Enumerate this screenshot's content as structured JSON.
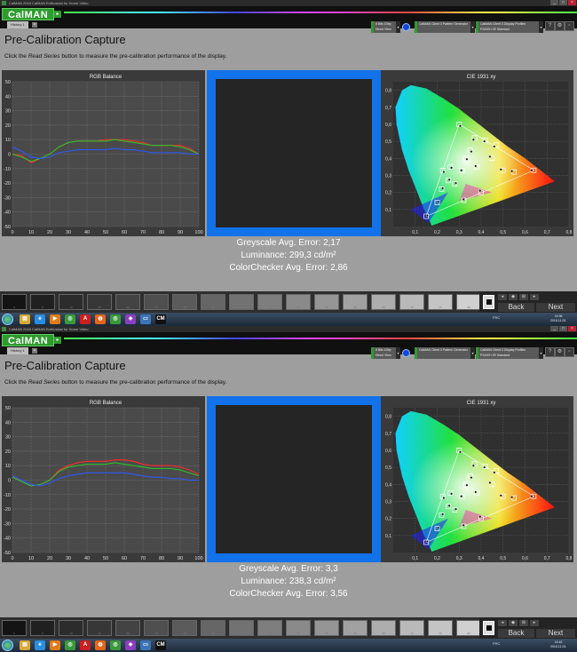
{
  "window": {
    "title": "CalMAN 2018 CalMAN Enthusiast for Home Video",
    "buttons": [
      "_",
      "□",
      "×"
    ]
  },
  "app": {
    "logo": "CalMAN",
    "logo_arrow": "▸",
    "history_tab": "History 1",
    "tab_close": "×",
    "dropdowns": [
      {
        "line1": "6 Bits 10bp",
        "line2": "Direct View"
      },
      {
        "line1": "CalMAN Client 3 Pattern Generator",
        "line2": ""
      },
      {
        "line1": "CalMAN Client 3 Display Profiles",
        "line2": "P2420H 2E Standard"
      }
    ],
    "dropdown_arrow": "▾",
    "tools": [
      "?",
      "⚙",
      "▫",
      "◉"
    ]
  },
  "page": {
    "title": "Pre-Calibration Capture",
    "instructions_pre": "Click the ",
    "instructions_em": "Read Series",
    "instructions_post": " button to measure the pre-calibration performance of the display."
  },
  "rgb_chart_title": "RGB Balance",
  "cie_chart_title": "CIE 1931 xy",
  "swatch_labels": [
    "0",
    "5",
    "10",
    "15",
    "20",
    "25",
    "30",
    "35",
    "40",
    "45",
    "50",
    "55",
    "60",
    "65",
    "70",
    "75",
    "80",
    "85",
    "90",
    "95",
    "100"
  ],
  "nav": {
    "back": "Back",
    "next": "Next",
    "mini": [
      "◂",
      "◆",
      "⊞",
      "▸"
    ]
  },
  "taskbar": {
    "icons": [
      {
        "name": "folder-icon",
        "glyph": "▤",
        "color": "#d8a93a"
      },
      {
        "name": "ie-icon",
        "glyph": "e",
        "color": "#2a8ddf"
      },
      {
        "name": "media-player-icon",
        "glyph": "▶",
        "color": "#e07b1a"
      },
      {
        "name": "chrome-icon",
        "glyph": "◎",
        "color": "#3a9a3a"
      },
      {
        "name": "avira-icon",
        "glyph": "A",
        "color": "#cc1f1f"
      },
      {
        "name": "firefox-icon",
        "glyph": "◍",
        "color": "#e5661a"
      },
      {
        "name": "chrome-icon-2",
        "glyph": "◎",
        "color": "#3a9a3a"
      },
      {
        "name": "app-icon",
        "glyph": "◈",
        "color": "#8a3fbf"
      },
      {
        "name": "window-icon",
        "glyph": "▭",
        "color": "#3b74b8"
      },
      {
        "name": "calman-icon",
        "glyph": "CM",
        "color": "#111111"
      }
    ],
    "tray": "FRC"
  },
  "screens": [
    {
      "clock_time": "16:36",
      "clock_date": "2018.11.03.",
      "stats": {
        "greyscale": "Greyscale Avg. Error: 2,17",
        "luminance": "Luminance: 299,3 cd/m²",
        "colorchecker": "ColorChecker Avg. Error: 2,86"
      },
      "chart_data": {
        "type": "line",
        "title": "RGB Balance",
        "x": [
          0,
          5,
          10,
          15,
          20,
          25,
          30,
          35,
          40,
          45,
          50,
          55,
          60,
          65,
          70,
          75,
          80,
          85,
          90,
          95,
          100
        ],
        "xlim": [
          0,
          100
        ],
        "ylim": [
          -50,
          50
        ],
        "xticks": [
          0,
          10,
          20,
          30,
          40,
          50,
          60,
          70,
          80,
          90,
          100
        ],
        "yticks": [
          -50,
          -40,
          -30,
          -20,
          -10,
          0,
          10,
          20,
          30,
          40,
          50
        ],
        "grid": true,
        "series": [
          {
            "color": "#ff2a2a",
            "values": [
              0,
              -1,
              -6,
              -3,
              0,
              5,
              8,
              9,
              9,
              9,
              10,
              10,
              10,
              9,
              8,
              6,
              6,
              6,
              6,
              4,
              0
            ]
          },
          {
            "color": "#2ac02a",
            "values": [
              0,
              -2,
              -5,
              -3,
              0,
              5,
              8,
              9,
              9,
              9,
              9,
              10,
              9,
              8,
              7,
              6,
              6,
              6,
              5,
              3,
              0
            ]
          },
          {
            "color": "#2a5aff",
            "values": [
              5,
              2,
              -2,
              -3,
              -2,
              1,
              2,
              3,
              3,
              3,
              3,
              4,
              3,
              3,
              2,
              1,
              1,
              1,
              1,
              0,
              0
            ]
          }
        ]
      }
    },
    {
      "clock_time": "16:42",
      "clock_date": "2018.11.03.",
      "stats": {
        "greyscale": "Greyscale Avg. Error: 3,3",
        "luminance": "Luminance: 238,3 cd/m²",
        "colorchecker": "ColorChecker Avg. Error: 3,56"
      },
      "chart_data": {
        "type": "line",
        "title": "RGB Balance",
        "x": [
          0,
          5,
          10,
          15,
          20,
          25,
          30,
          35,
          40,
          45,
          50,
          55,
          60,
          65,
          70,
          75,
          80,
          85,
          90,
          95,
          100
        ],
        "xlim": [
          0,
          100
        ],
        "ylim": [
          -50,
          50
        ],
        "xticks": [
          0,
          10,
          20,
          30,
          40,
          50,
          60,
          70,
          80,
          90,
          100
        ],
        "yticks": [
          -50,
          -40,
          -30,
          -20,
          -10,
          0,
          10,
          20,
          30,
          40,
          50
        ],
        "grid": true,
        "series": [
          {
            "color": "#ff2a2a",
            "values": [
              3,
              -1,
              -4,
              -3,
              0,
              7,
              10,
              12,
              13,
              13,
              13,
              14,
              14,
              13,
              11,
              10,
              10,
              10,
              9,
              7,
              4
            ]
          },
          {
            "color": "#2ac02a",
            "values": [
              2,
              -1,
              -4,
              -3,
              0,
              6,
              9,
              10,
              11,
              11,
              11,
              12,
              11,
              10,
              9,
              8,
              8,
              8,
              7,
              5,
              3
            ]
          },
          {
            "color": "#2a5aff",
            "values": [
              3,
              0,
              -3,
              -4,
              -2,
              1,
              3,
              4,
              5,
              5,
              5,
              5,
              5,
              4,
              3,
              2,
              2,
              1,
              1,
              0,
              0
            ]
          }
        ]
      }
    }
  ],
  "cie_chart": {
    "type": "scatter",
    "title": "CIE 1931 xy",
    "xlim": [
      0,
      0.8
    ],
    "ylim": [
      0,
      0.85
    ],
    "xticks": [
      "0,1",
      "0,2",
      "0,3",
      "0,4",
      "0,5",
      "0,6",
      "0,7",
      "0,8"
    ],
    "yticks": [
      "0,1",
      "0,2",
      "0,3",
      "0,4",
      "0,5",
      "0,6",
      "0,7",
      "0,8"
    ],
    "gamut_triangle": [
      [
        0.64,
        0.33
      ],
      [
        0.3,
        0.6
      ],
      [
        0.15,
        0.06
      ]
    ],
    "targets": [
      [
        0.64,
        0.33
      ],
      [
        0.3,
        0.6
      ],
      [
        0.15,
        0.06
      ],
      [
        0.225,
        0.329
      ],
      [
        0.321,
        0.154
      ],
      [
        0.419,
        0.505
      ],
      [
        0.313,
        0.329
      ],
      [
        0.26,
        0.35
      ],
      [
        0.38,
        0.35
      ],
      [
        0.45,
        0.4
      ],
      [
        0.35,
        0.45
      ],
      [
        0.28,
        0.25
      ],
      [
        0.4,
        0.2
      ],
      [
        0.5,
        0.33
      ],
      [
        0.2,
        0.14
      ],
      [
        0.25,
        0.27
      ],
      [
        0.37,
        0.52
      ],
      [
        0.47,
        0.48
      ],
      [
        0.55,
        0.32
      ],
      [
        0.33,
        0.4
      ],
      [
        0.22,
        0.22
      ]
    ],
    "measured": [
      [
        0.63,
        0.33
      ],
      [
        0.305,
        0.59
      ],
      [
        0.155,
        0.065
      ],
      [
        0.23,
        0.32
      ],
      [
        0.32,
        0.16
      ],
      [
        0.415,
        0.5
      ],
      [
        0.31,
        0.33
      ],
      [
        0.265,
        0.345
      ],
      [
        0.375,
        0.355
      ],
      [
        0.44,
        0.41
      ],
      [
        0.355,
        0.44
      ],
      [
        0.285,
        0.255
      ],
      [
        0.395,
        0.21
      ],
      [
        0.49,
        0.335
      ],
      [
        0.205,
        0.145
      ],
      [
        0.255,
        0.275
      ],
      [
        0.365,
        0.51
      ],
      [
        0.46,
        0.47
      ],
      [
        0.54,
        0.325
      ],
      [
        0.335,
        0.395
      ],
      [
        0.225,
        0.225
      ]
    ]
  }
}
